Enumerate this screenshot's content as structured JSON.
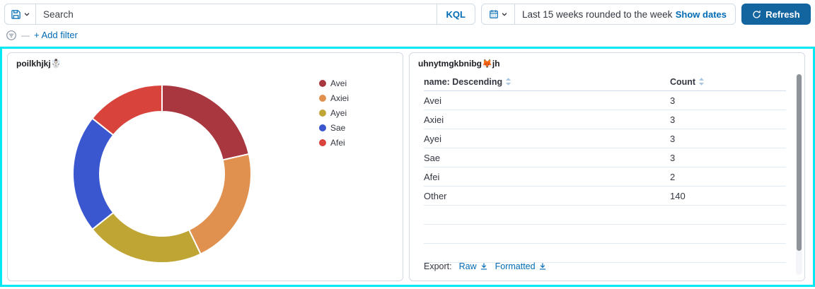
{
  "topbar": {
    "search_placeholder": "Search",
    "kql_label": "KQL",
    "date_range_text": "Last 15 weeks rounded to the week",
    "show_dates_label": "Show dates",
    "refresh_label": "Refresh"
  },
  "filter_bar": {
    "add_filter_label": "+ Add filter"
  },
  "table_footer": {
    "export_label": "Export:",
    "raw_label": "Raw",
    "formatted_label": "Formatted"
  },
  "chart_data": [
    {
      "type": "pie",
      "title": "poilkhjkj☃️",
      "labels": [
        "Avei",
        "Axiei",
        "Ayei",
        "Sae",
        "Afei"
      ],
      "values": [
        3,
        3,
        3,
        3,
        2
      ],
      "colors": [
        "#a93740",
        "#e0914f",
        "#bfa634",
        "#3a57cf",
        "#d8433c"
      ],
      "donut": true,
      "inner_radius_ratio": 0.7,
      "start_angle_deg": 0,
      "direction": "clockwise",
      "legend_position": "right"
    },
    {
      "type": "table",
      "title": "uhnytmgkbnibg🦊jh",
      "columns": [
        "name: Descending",
        "Count"
      ],
      "rows": [
        [
          "Avei",
          "3"
        ],
        [
          "Axiei",
          "3"
        ],
        [
          "Ayei",
          "3"
        ],
        [
          "Sae",
          "3"
        ],
        [
          "Afei",
          "2"
        ],
        [
          "Other",
          "140"
        ]
      ]
    }
  ],
  "colors": {
    "link_blue": "#006bb4",
    "refresh_button_bg": "#13659f",
    "selection_border": "#00e8f4",
    "panel_border": "#d3dae6"
  }
}
